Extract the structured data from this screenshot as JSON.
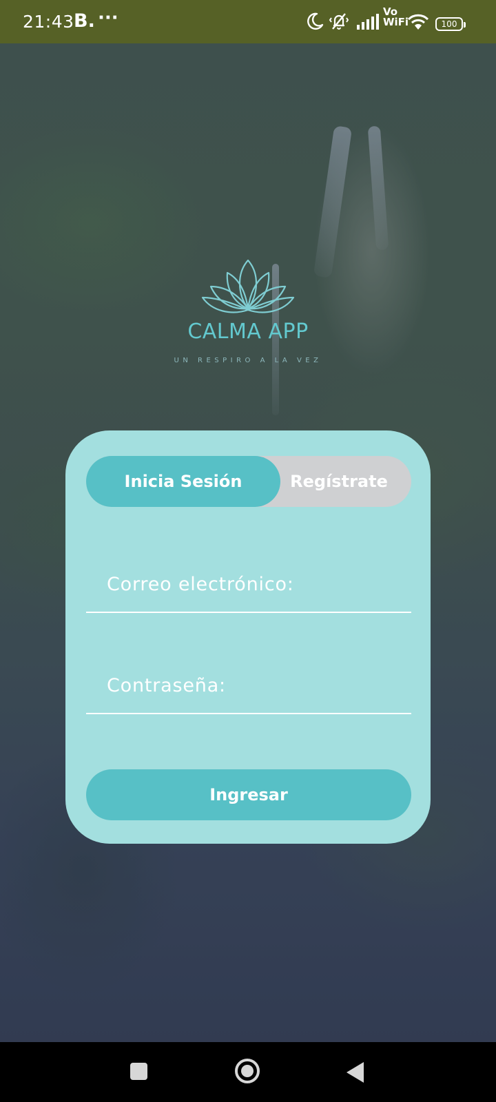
{
  "status_bar": {
    "time": "21:43",
    "app_letter": "B.",
    "more": "···",
    "vowifi_line1": "Vo",
    "vowifi_line2": "WiFi",
    "battery": "100",
    "background_color": "#566126"
  },
  "logo": {
    "app_name": "CALMA APP",
    "tagline": "UN RESPIRO A LA VEZ",
    "icon": "lotus-icon",
    "color": "#63c9cf"
  },
  "auth_tabs": {
    "login_label": "Inicia Sesión",
    "register_label": "Regístrate",
    "active": "login"
  },
  "form": {
    "email_placeholder": "Correo electrónico:",
    "email_value": "",
    "password_placeholder": "Contraseña:",
    "password_value": "",
    "submit_label": "Ingresar"
  },
  "colors": {
    "card": "#a3dfdf",
    "accent": "#57c0c6",
    "inactive_tab": "#cfd0d2"
  },
  "nav_bar": {
    "icons": [
      "recents-icon",
      "home-icon",
      "back-icon"
    ]
  }
}
